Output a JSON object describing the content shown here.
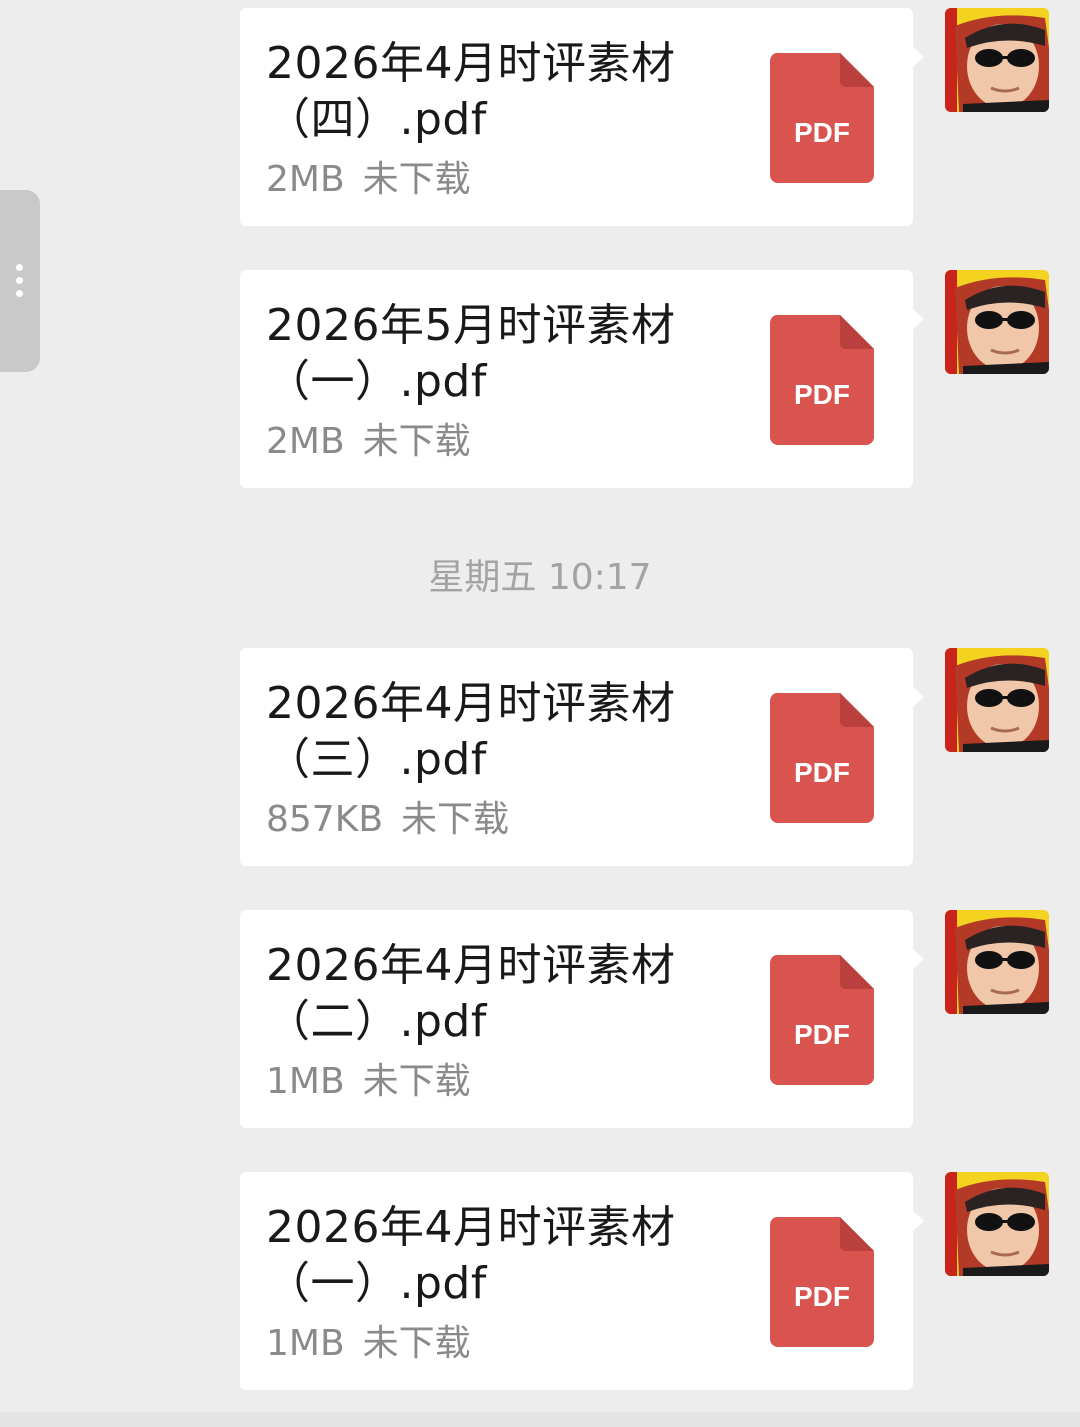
{
  "timestamp": "星期五 10:17",
  "pdf_badge": "PDF",
  "colors": {
    "background": "#ededed",
    "bubble": "#ffffff",
    "pdf_red": "#d9534f",
    "pdf_fold": "#b9403c",
    "meta_text": "#8a8a8a"
  },
  "messages": [
    {
      "name_line1": "2026年4月时评素材",
      "name_line2": "（四）.pdf",
      "size": "2MB",
      "status": "未下载"
    },
    {
      "name_line1": "2026年5月时评素材",
      "name_line2": "（一）.pdf",
      "size": "2MB",
      "status": "未下载"
    },
    {
      "name_line1": "2026年4月时评素材",
      "name_line2": "（三）.pdf",
      "size": "857KB",
      "status": "未下载"
    },
    {
      "name_line1": "2026年4月时评素材",
      "name_line2": "（二）.pdf",
      "size": "1MB",
      "status": "未下载"
    },
    {
      "name_line1": "2026年4月时评素材",
      "name_line2": "（一）.pdf",
      "size": "1MB",
      "status": "未下载"
    }
  ]
}
